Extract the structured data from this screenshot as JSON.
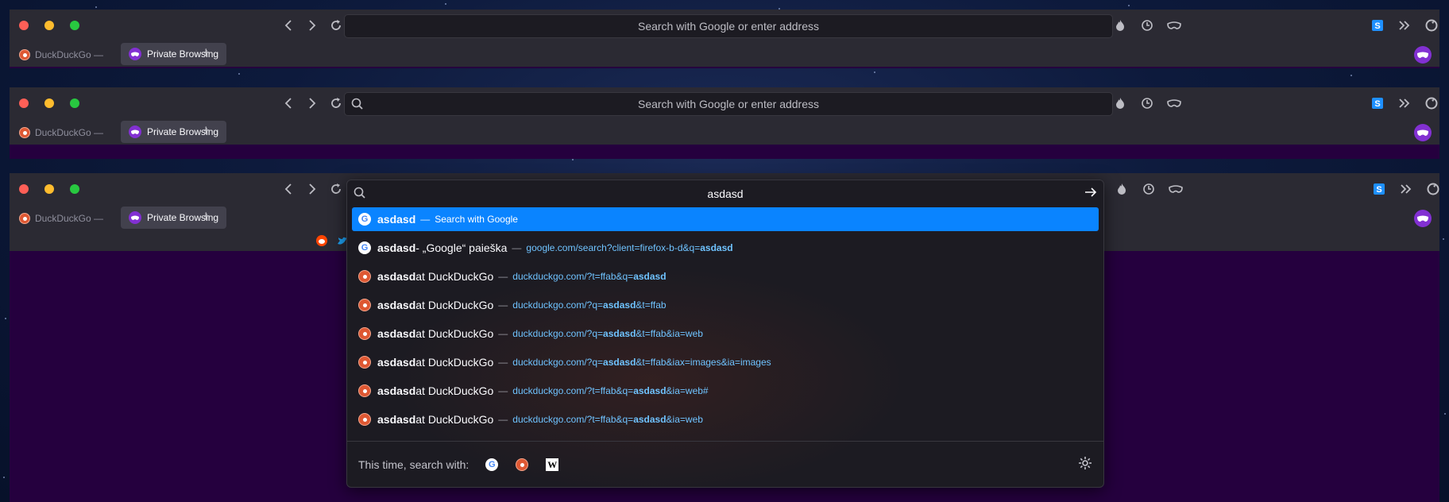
{
  "window": {
    "urlbar_placeholder": "Search with Google or enter address",
    "tab_inactive_label": "DuckDuckGo —",
    "tab_active_label": "Private Browsing",
    "new_tab_symbol": "+"
  },
  "dropdown": {
    "query": "asdasd",
    "results": [
      {
        "icon": "google-icon",
        "title_bold": "asdasd",
        "title_rest": "",
        "action": "Search with Google",
        "url_pre": "",
        "url_bold": "",
        "url_post": "",
        "selected": true
      },
      {
        "icon": "google-icon",
        "title_bold": "asdasd",
        "title_rest": " - „Google“ paieška",
        "action": "",
        "url_pre": "google.com/search?client=firefox-b-d&q=",
        "url_bold": "asdasd",
        "url_post": "",
        "selected": false
      },
      {
        "icon": "duckduckgo-icon",
        "title_bold": "asdasd",
        "title_rest": " at DuckDuckGo",
        "action": "",
        "url_pre": "duckduckgo.com/?t=ffab&q=",
        "url_bold": "asdasd",
        "url_post": "",
        "selected": false
      },
      {
        "icon": "duckduckgo-icon",
        "title_bold": "asdasd",
        "title_rest": " at DuckDuckGo",
        "action": "",
        "url_pre": "duckduckgo.com/?q=",
        "url_bold": "asdasd",
        "url_post": "&t=ffab",
        "selected": false
      },
      {
        "icon": "duckduckgo-icon",
        "title_bold": "asdasd",
        "title_rest": " at DuckDuckGo",
        "action": "",
        "url_pre": "duckduckgo.com/?q=",
        "url_bold": "asdasd",
        "url_post": "&t=ffab&ia=web",
        "selected": false
      },
      {
        "icon": "duckduckgo-icon",
        "title_bold": "asdasd",
        "title_rest": " at DuckDuckGo",
        "action": "",
        "url_pre": "duckduckgo.com/?q=",
        "url_bold": "asdasd",
        "url_post": "&t=ffab&iax=images&ia=images",
        "selected": false
      },
      {
        "icon": "duckduckgo-icon",
        "title_bold": "asdasd",
        "title_rest": " at DuckDuckGo",
        "action": "",
        "url_pre": "duckduckgo.com/?t=ffab&q=",
        "url_bold": "asdasd",
        "url_post": "&ia=web#",
        "selected": false
      },
      {
        "icon": "duckduckgo-icon",
        "title_bold": "asdasd",
        "title_rest": " at DuckDuckGo",
        "action": "",
        "url_pre": "duckduckgo.com/?t=ffab&q=",
        "url_bold": "asdasd",
        "url_post": "&ia=web",
        "selected": false
      }
    ],
    "separator": "—",
    "footer_label": "This time, search with:",
    "engines": [
      "google-icon",
      "duckduckgo-icon",
      "wikipedia-icon"
    ],
    "wikipedia_glyph": "W"
  },
  "colors": {
    "toolbar_bg": "#2b2a33",
    "urlbar_bg": "#1c1b22",
    "selected_row": "#0a84ff",
    "private_purple": "#8230d2",
    "content_purple": "#25003e"
  }
}
